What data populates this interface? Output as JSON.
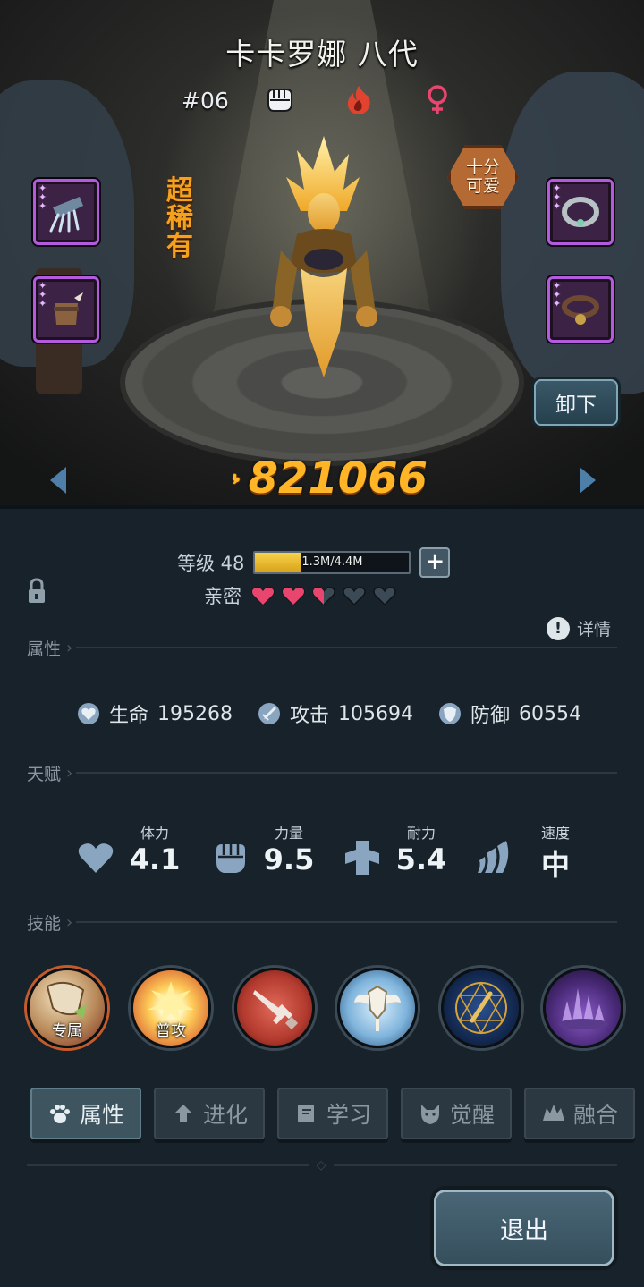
{
  "hero": {
    "name": "卡卡罗娜 八代",
    "number": "#06",
    "rarity": "超\n稀\n有",
    "trait_badge": "十分\n可爱",
    "power": "821066"
  },
  "actions": {
    "unequip_label": "卸下",
    "exit_label": "退出"
  },
  "level": {
    "label": "等级 48",
    "xp_text": "1.3M/4.4M",
    "xp_fraction": 0.295
  },
  "intimacy": {
    "label": "亲密",
    "hearts_filled": 2.5,
    "hearts_total": 5
  },
  "details_label": "详情",
  "sections": {
    "attributes": "属性",
    "talent": "天赋",
    "skills": "技能"
  },
  "stats": [
    {
      "label": "生命",
      "value": "195268",
      "icon": "heart-shield-icon"
    },
    {
      "label": "攻击",
      "value": "105694",
      "icon": "sword-icon"
    },
    {
      "label": "防御",
      "value": "60554",
      "icon": "shield-icon"
    }
  ],
  "talents": [
    {
      "label": "体力",
      "value": "4.1",
      "icon": "heart-icon"
    },
    {
      "label": "力量",
      "value": "9.5",
      "icon": "fist-icon"
    },
    {
      "label": "耐力",
      "value": "5.4",
      "icon": "muscle-icon"
    },
    {
      "label": "速度",
      "value": "中",
      "icon": "wing-icon"
    }
  ],
  "skills": [
    {
      "tag": "专属",
      "icon": "claw-skill-icon",
      "colors": [
        "#e8d6b0",
        "#7a2a1c"
      ]
    },
    {
      "tag": "普攻",
      "icon": "burst-skill-icon",
      "colors": [
        "#ffe38a",
        "#c0522a"
      ]
    },
    {
      "tag": "",
      "icon": "sword-skill-icon",
      "colors": [
        "#c94a3c",
        "#6a1c18"
      ]
    },
    {
      "tag": "",
      "icon": "winged-shield-skill-icon",
      "colors": [
        "#9cc7e8",
        "#2f5f8c"
      ]
    },
    {
      "tag": "",
      "icon": "rune-circle-skill-icon",
      "colors": [
        "#1d3c6a",
        "#0b1a33"
      ]
    },
    {
      "tag": "",
      "icon": "shadow-spikes-skill-icon",
      "colors": [
        "#7a4ab8",
        "#231438"
      ]
    }
  ],
  "tabs": [
    {
      "label": "属性",
      "icon": "paw-icon",
      "active": true
    },
    {
      "label": "进化",
      "icon": "arrow-up-icon",
      "active": false
    },
    {
      "label": "学习",
      "icon": "book-icon",
      "active": false
    },
    {
      "label": "觉醒",
      "icon": "wolf-icon",
      "active": false
    },
    {
      "label": "融合",
      "icon": "beast-icon",
      "active": false
    }
  ],
  "equipment": [
    {
      "slot": "claw-gauntlet-icon"
    },
    {
      "slot": "collar-icon"
    },
    {
      "slot": "spiked-helmet-icon"
    },
    {
      "slot": "bell-collar-icon"
    }
  ],
  "colors": {
    "accent_gold": "#ffb526",
    "rarity_orange": "#f4a21e",
    "epic_purple": "#b45adf",
    "heart_pink": "#e8456f",
    "fire_red": "#e2432f"
  }
}
